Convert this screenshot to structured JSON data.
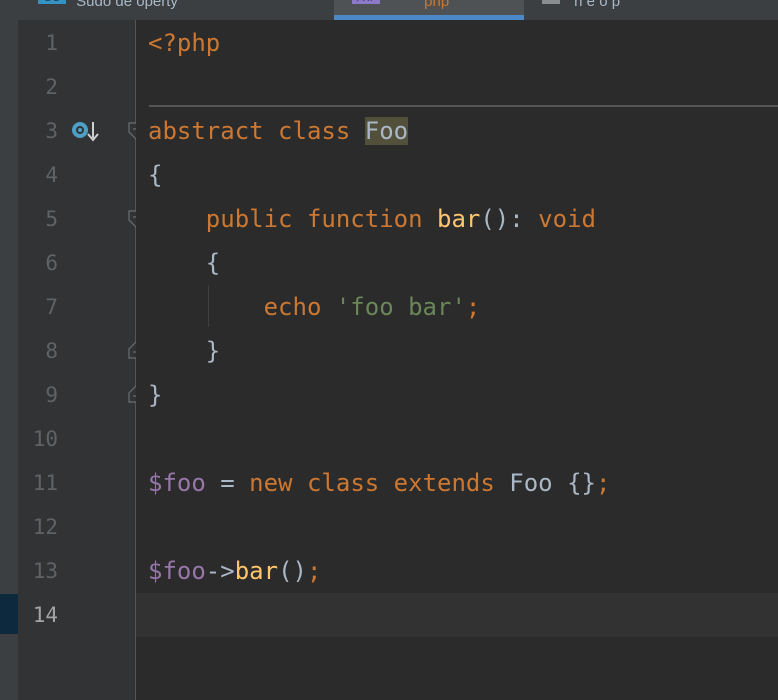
{
  "tabs": [
    {
      "label": "Sudo de operty",
      "icon": "dc-file-icon",
      "active": false
    },
    {
      "label": "php",
      "icon": "php-file-icon",
      "active": true
    },
    {
      "label": "n e o p",
      "icon": "file-icon",
      "active": false
    }
  ],
  "gutter": {
    "line_numbers": [
      "1",
      "2",
      "3",
      "4",
      "5",
      "6",
      "7",
      "8",
      "9",
      "10",
      "11",
      "12",
      "13",
      "14"
    ],
    "current_line": "14"
  },
  "code": {
    "line1": {
      "open_tag": "<?php"
    },
    "line3": {
      "abstract": "abstract",
      "class": "class",
      "name": "Foo"
    },
    "line4": {
      "brace": "{"
    },
    "line5": {
      "public": "public",
      "function": "function",
      "name": "bar",
      "parens": "():",
      "type": "void"
    },
    "line6": {
      "brace": "{"
    },
    "line7": {
      "echo": "echo",
      "string": "'foo bar'",
      "semi": ";"
    },
    "line8": {
      "brace": "}"
    },
    "line9": {
      "brace": "}"
    },
    "line11": {
      "var": "$foo",
      "eq": "=",
      "new": "new",
      "class": "class",
      "extends": "extends",
      "name": "Foo",
      "body": "{}",
      "semi": ";"
    },
    "line13": {
      "var": "$foo",
      "arrow": "->",
      "method": "bar",
      "parens": "()",
      "semi": ";"
    }
  },
  "colors": {
    "keyword": "#cc7832",
    "function": "#ffc66d",
    "string": "#6a8759",
    "variable": "#9876aa",
    "text": "#a9b7c6",
    "background": "#2b2b2b",
    "gutter": "#313335"
  }
}
